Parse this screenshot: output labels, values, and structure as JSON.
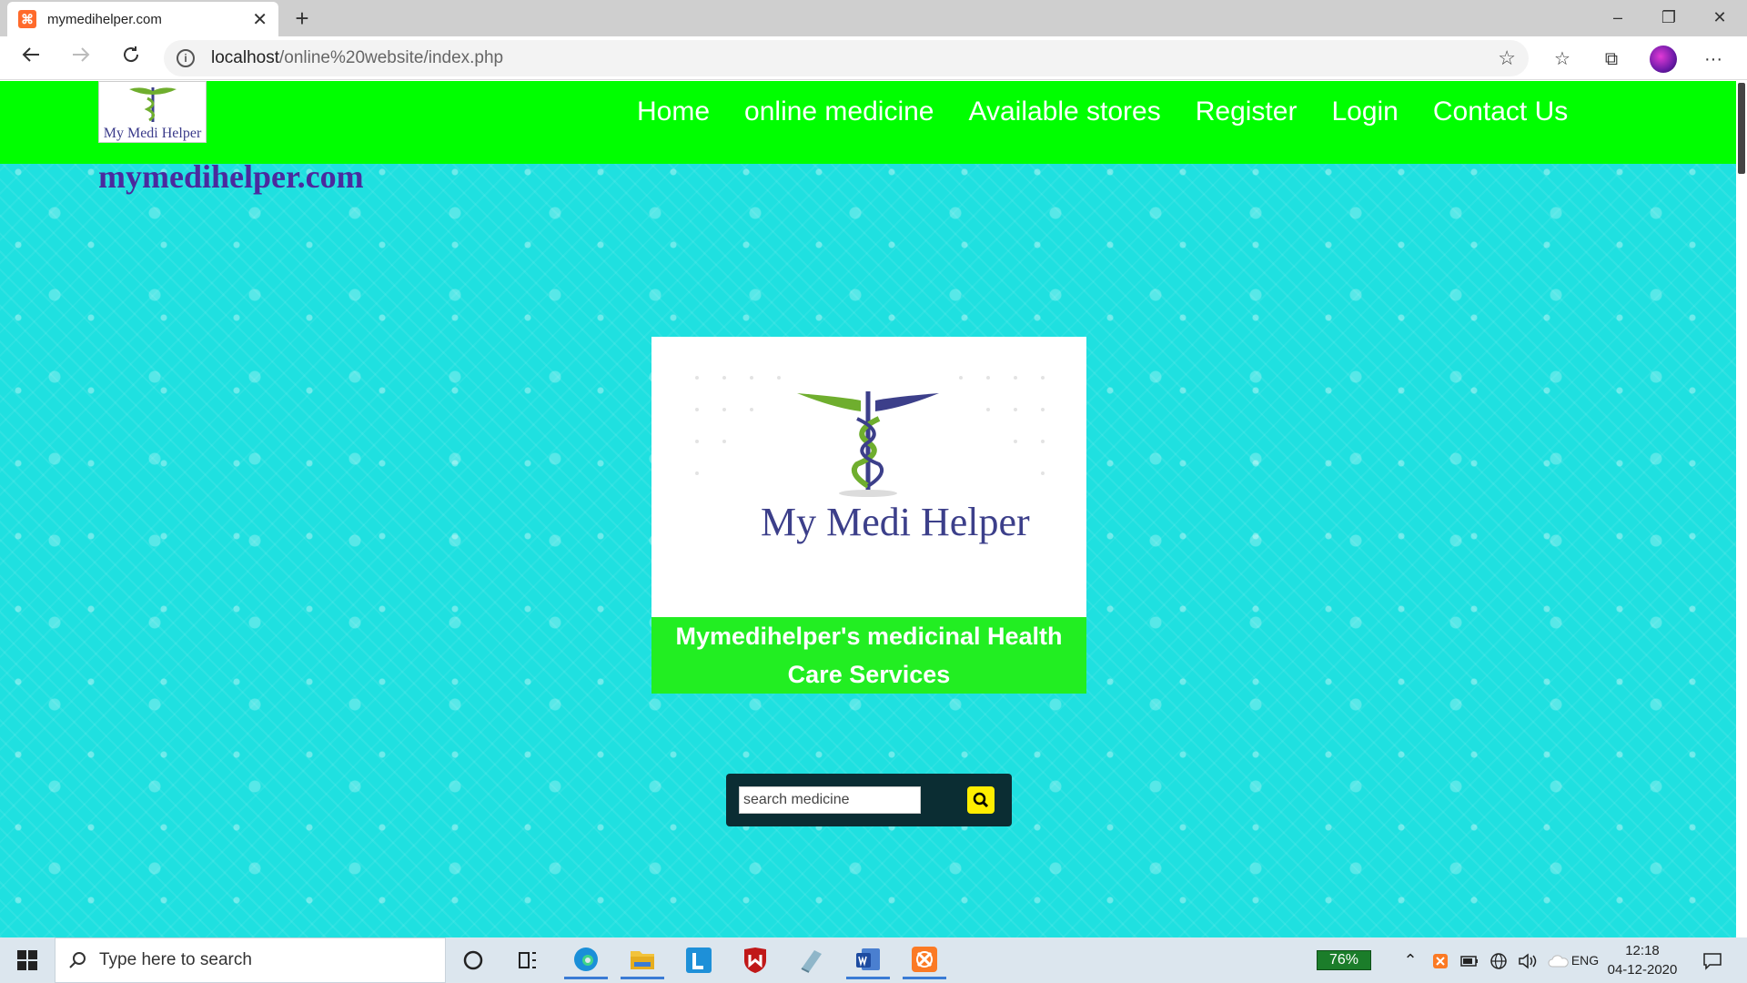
{
  "browser": {
    "tab_title": "mymedihelper.com",
    "favicon_glyph": "⌘",
    "close_glyph": "✕",
    "new_tab_glyph": "+",
    "url_host": "localhost",
    "url_path": "/online%20website/index.php",
    "window_controls": {
      "minimize": "–",
      "maximize": "❐",
      "close": "✕"
    },
    "more_glyph": "···"
  },
  "site": {
    "logo_text": "My Medi Helper",
    "domain_text": "mymedihelper.com",
    "nav": [
      "Home",
      "online medicine",
      "Available stores",
      "Register",
      "Login",
      "Contact Us"
    ],
    "hero_title": "My Medi Helper",
    "hero_caption": "Mymedihelper's medicinal Health Care Services",
    "search": {
      "placeholder": "search medicine",
      "value": ""
    },
    "colors": {
      "header": "#00ff00",
      "background": "#1fe0e0",
      "caption": "#22ee22",
      "search_button": "#ffee00",
      "domain_text": "#4b2a9e"
    }
  },
  "taskbar": {
    "search_text": "Type here to search",
    "battery_percent": "76%",
    "language": "ENG",
    "time": "12:18",
    "date": "04-12-2020",
    "apps": [
      "cortana-icon",
      "task-view-icon",
      "edge-icon",
      "file-explorer-icon",
      "l-app-icon",
      "mcafee-icon",
      "notes-icon",
      "word-icon",
      "xampp-icon"
    ]
  }
}
